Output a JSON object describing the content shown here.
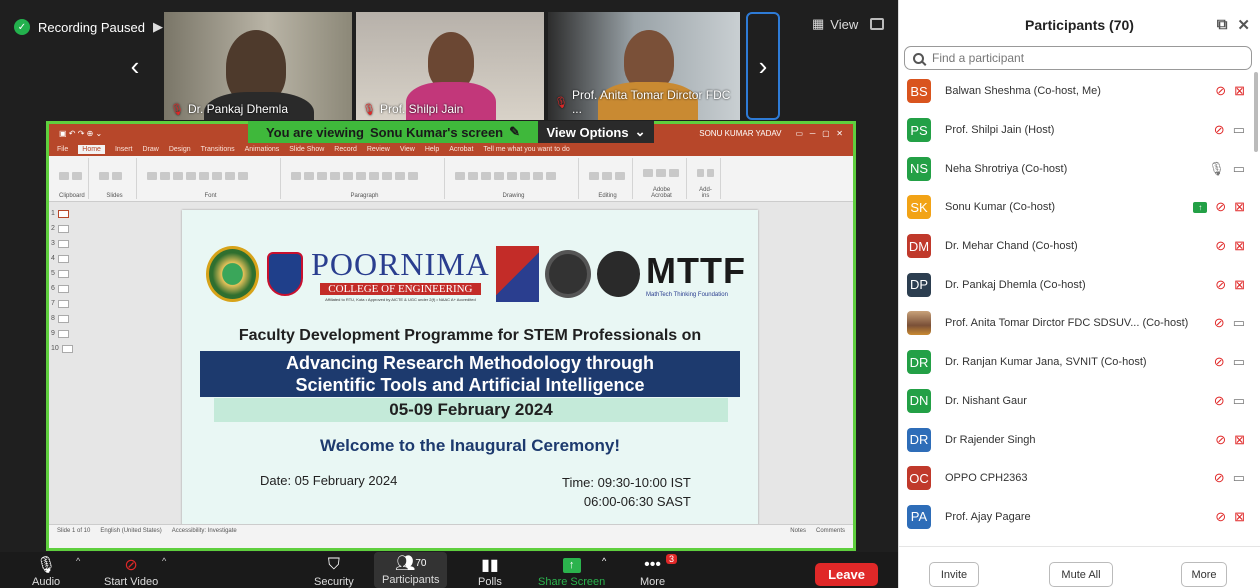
{
  "recording": {
    "status": "Recording Paused"
  },
  "view_label": "View",
  "videos": [
    {
      "name": "Dr. Pankaj Dhemla"
    },
    {
      "name": "Prof. Shilpi Jain"
    },
    {
      "name": "Prof. Anita Tomar Dirctor FDC ..."
    }
  ],
  "share": {
    "banner_prefix": "You are viewing",
    "banner_name": "Sonu Kumar's screen",
    "view_options": "View Options"
  },
  "ppt": {
    "user": "SONU KUMAR YADAV",
    "tabs": [
      "File",
      "Home",
      "Insert",
      "Draw",
      "Design",
      "Transitions",
      "Animations",
      "Slide Show",
      "Record",
      "Review",
      "View",
      "Help",
      "Acrobat",
      "Tell me what you want to do"
    ],
    "groups": [
      "Clipboard",
      "Slides",
      "Font",
      "Paragraph",
      "Drawing",
      "Editing",
      "Adobe Acrobat",
      "Add-ins"
    ],
    "thumbs": [
      "1",
      "2",
      "3",
      "4",
      "5",
      "6",
      "7",
      "8",
      "9",
      "10"
    ],
    "status_left": "Slide 1 of 10",
    "status_lang": "English (United States)",
    "status_access": "Accessibility: Investigate",
    "status_notes": "Notes",
    "status_comments": "Comments"
  },
  "slide": {
    "college_big": "POORNIMA",
    "college_sub": "COLLEGE OF ENGINEERING",
    "college_tiny": "Affiliated to RTU, Kota • Approved by AICTE & UGC under 2(f) • NAAC A+ Accredited",
    "mttf": "MTTF",
    "mttf_tag": "MathTech Thinking Foundation",
    "fdp_title": "Faculty Development Programme for STEM Professionals on",
    "title_line1": "Advancing Research Methodology through",
    "title_line2": "Scientific Tools and Artificial Intelligence",
    "dates": "05-09 February 2024",
    "welcome": "Welcome to the Inaugural Ceremony!",
    "date_line": "Date: 05 February 2024",
    "time_line1": "Time: 09:30-10:00 IST",
    "time_line2": "06:00-06:30 SAST"
  },
  "toolbar": {
    "audio": "Audio",
    "video": "Start Video",
    "security": "Security",
    "participants": "Participants",
    "participants_count": "70",
    "polls": "Polls",
    "share": "Share Screen",
    "more": "More",
    "more_badge": "3",
    "leave": "Leave"
  },
  "panel": {
    "title": "Participants (70)",
    "search_placeholder": "Find a participant",
    "participants": [
      {
        "initials": "BS",
        "color": "#d9541e",
        "name": "Balwan Sheshma (Co-host, Me)",
        "mic": "muted",
        "video": "off"
      },
      {
        "initials": "PS",
        "color": "#23a046",
        "name": "Prof. Shilpi Jain (Host)",
        "mic": "muted",
        "video": "on"
      },
      {
        "initials": "NS",
        "color": "#23a046",
        "name": "Neha Shrotriya (Co-host)",
        "mic": "on",
        "video": "on"
      },
      {
        "initials": "SK",
        "color": "#f2a316",
        "name": "Sonu Kumar (Co-host)",
        "mic": "muted",
        "video": "off",
        "sharing": true
      },
      {
        "initials": "DM",
        "color": "#c0392b",
        "name": "Dr. Mehar Chand (Co-host)",
        "mic": "muted",
        "video": "off"
      },
      {
        "initials": "DP",
        "color": "#2c3e50",
        "name": "Dr. Pankaj Dhemla (Co-host)",
        "mic": "muted",
        "video": "off"
      },
      {
        "initials": "",
        "color": "#8a6d4b",
        "name": "Prof. Anita Tomar Dirctor FDC SDSUV... (Co-host)",
        "mic": "muted",
        "video": "on",
        "photo": true
      },
      {
        "initials": "DR",
        "color": "#23a046",
        "name": "Dr. Ranjan Kumar Jana, SVNIT (Co-host)",
        "mic": "muted",
        "video": "on"
      },
      {
        "initials": "DN",
        "color": "#23a046",
        "name": "Dr. Nishant Gaur",
        "mic": "muted",
        "video": "on"
      },
      {
        "initials": "DR",
        "color": "#2e6db8",
        "name": "Dr Rajender Singh",
        "mic": "muted",
        "video": "off"
      },
      {
        "initials": "OC",
        "color": "#c0392b",
        "name": "OPPO CPH2363",
        "mic": "muted",
        "video": "on"
      },
      {
        "initials": "PA",
        "color": "#2e6db8",
        "name": "Prof. Ajay Pagare",
        "mic": "muted",
        "video": "off"
      }
    ],
    "invite": "Invite",
    "mute_all": "Mute All",
    "more": "More"
  }
}
